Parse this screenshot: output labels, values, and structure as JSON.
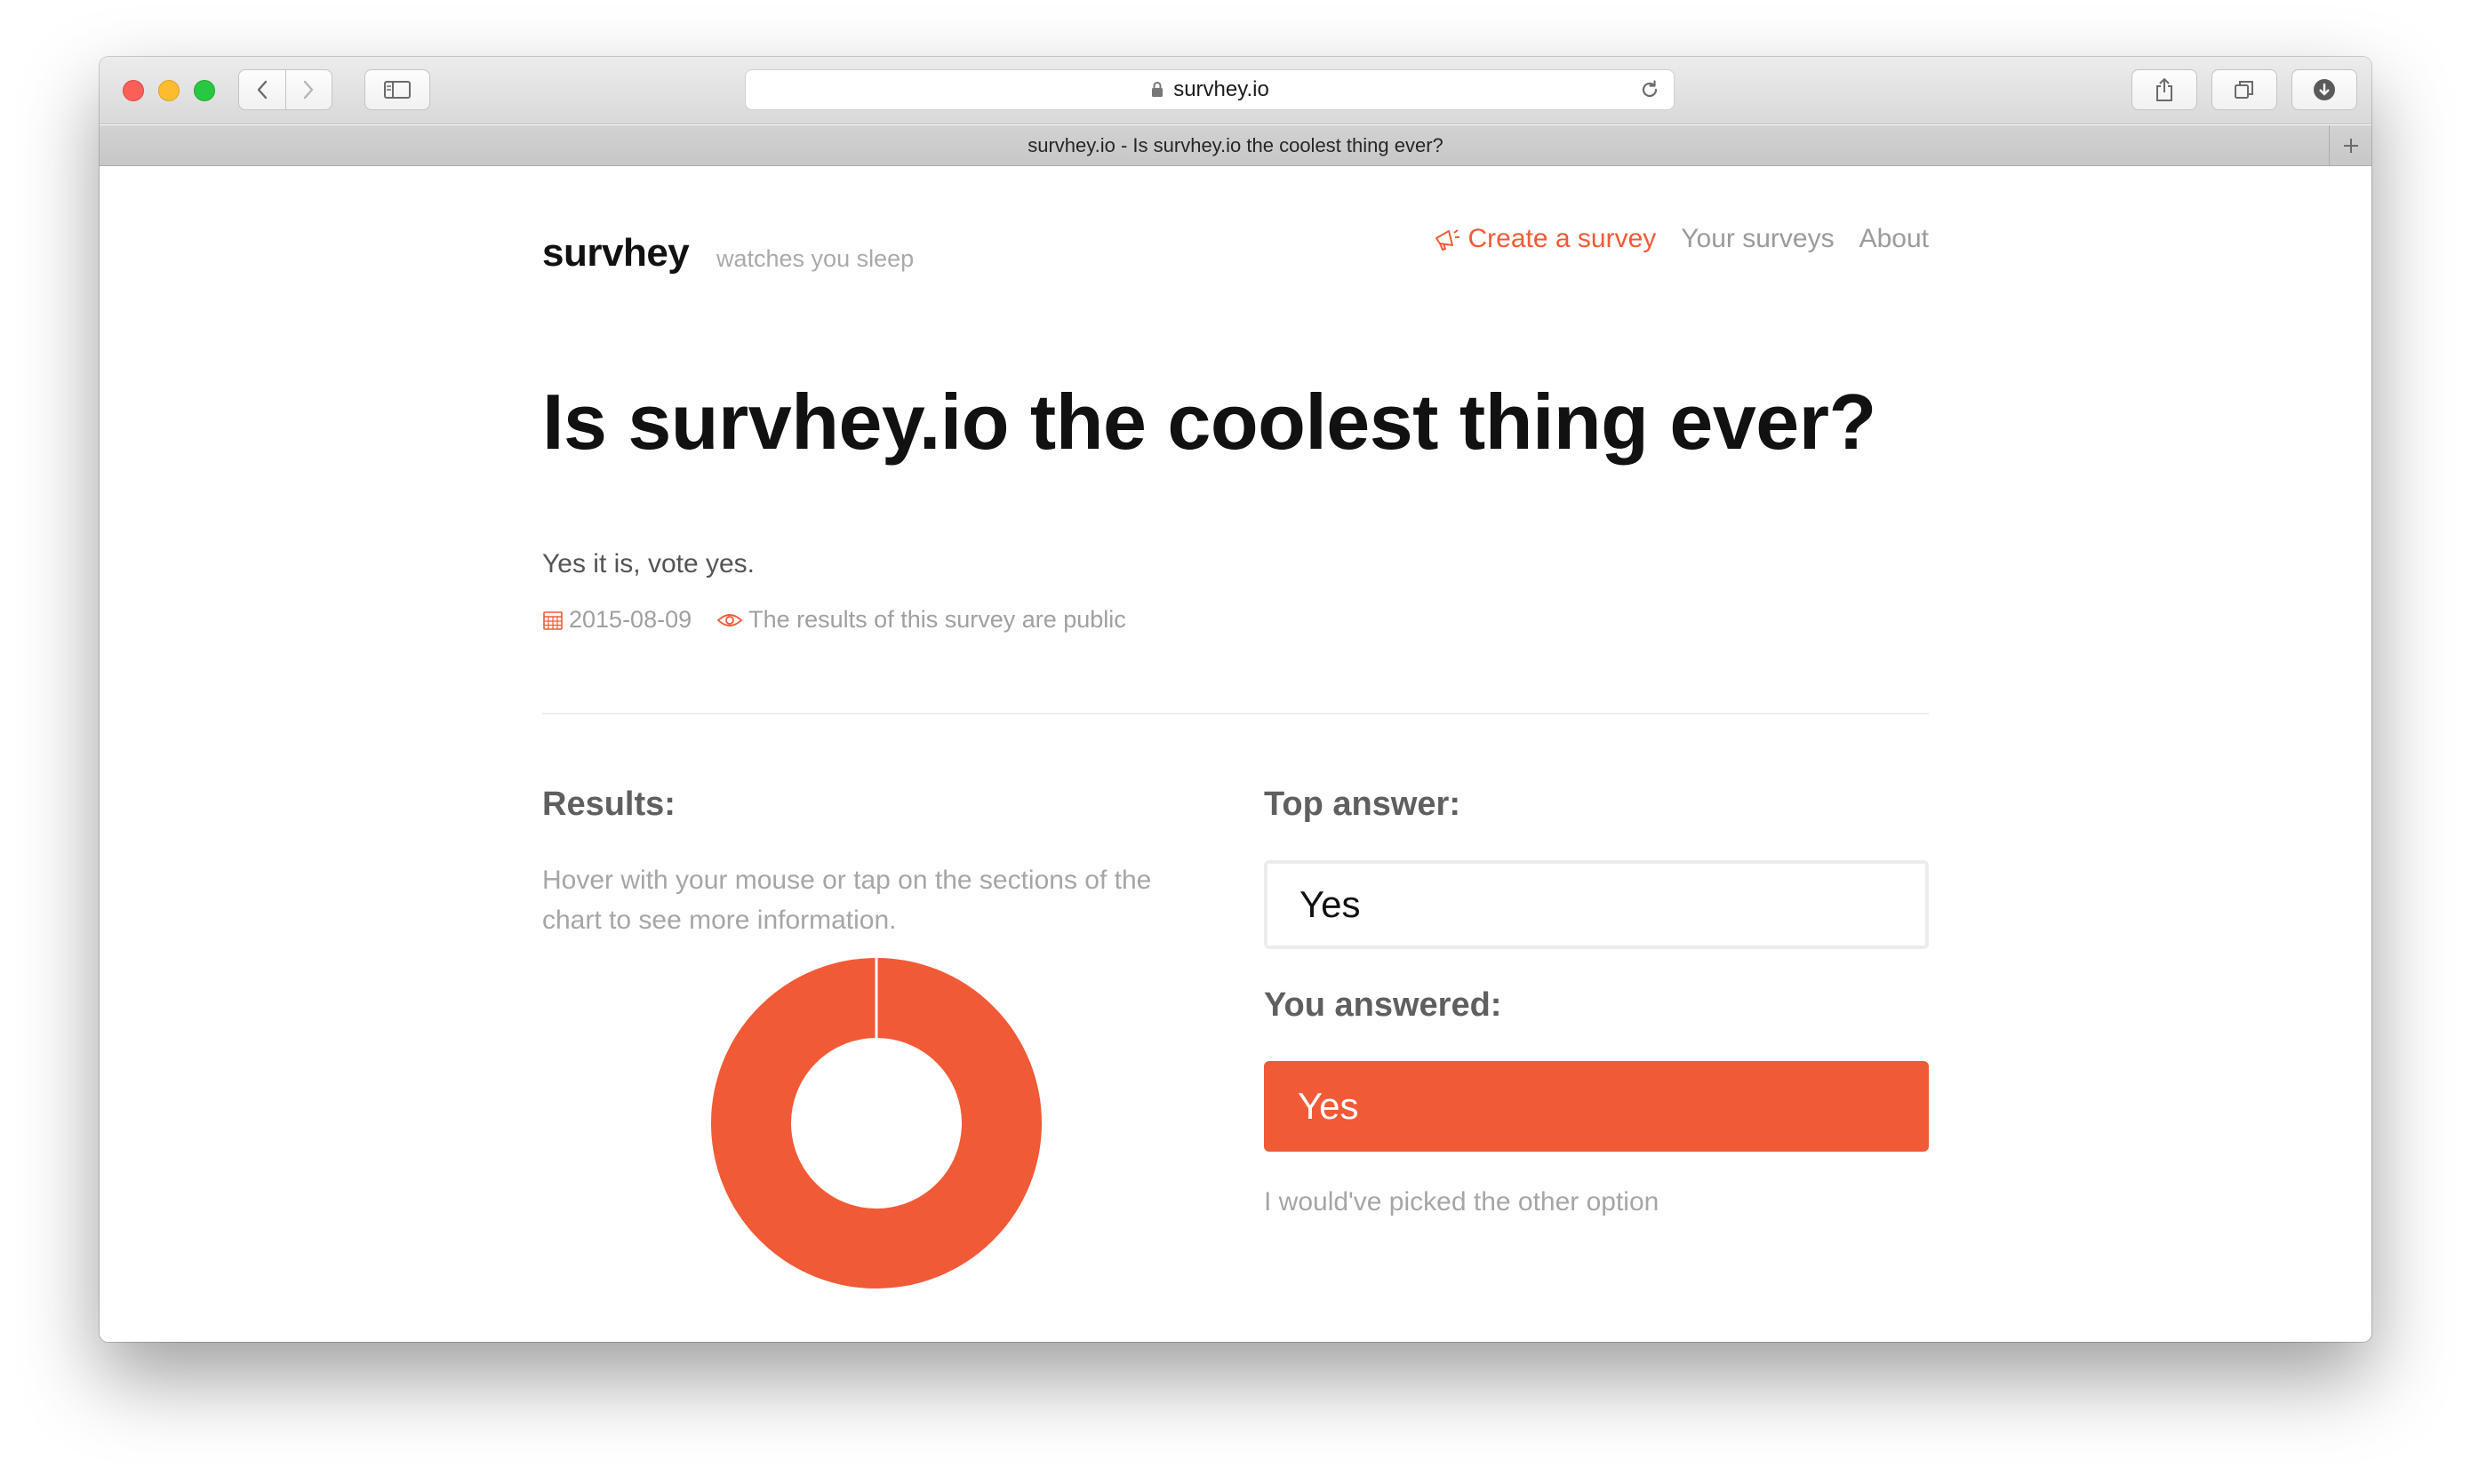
{
  "browser": {
    "url": "survhey.io",
    "tab_title": "survhey.io - Is survhey.io the coolest thing ever?"
  },
  "header": {
    "brand": "survhey",
    "tagline": "watches you sleep",
    "nav": {
      "create": "Create a survey",
      "surveys": "Your surveys",
      "about": "About"
    }
  },
  "survey": {
    "title": "Is survhey.io the coolest thing ever?",
    "description": "Yes it is, vote yes.",
    "date": "2015-08-09",
    "visibility": "The results of this survey are public"
  },
  "results": {
    "heading": "Results:",
    "hint": "Hover with your mouse or tap on the sections of the chart to see more information."
  },
  "answers": {
    "top_heading": "Top answer:",
    "top_answer": "Yes",
    "you_heading": "You answered:",
    "your_answer": "Yes",
    "change_link": "I would've picked the other option"
  },
  "colors": {
    "accent": "#f15a36"
  },
  "chart_data": {
    "type": "pie",
    "categories": [
      "Yes"
    ],
    "values": [
      100
    ],
    "colors": [
      "#f15a36"
    ],
    "donut": true
  }
}
